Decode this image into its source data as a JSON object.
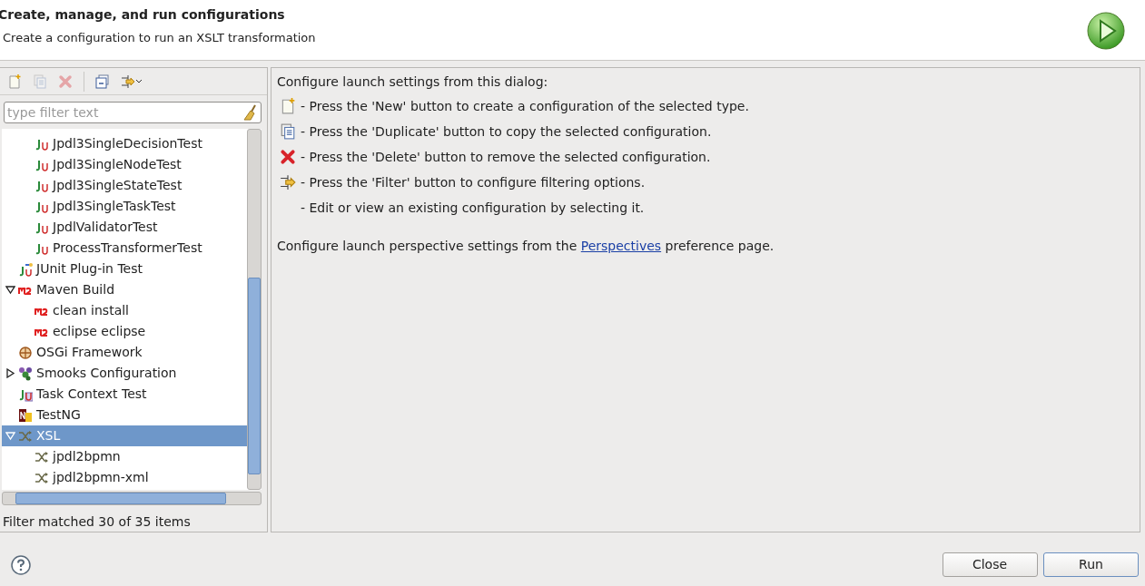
{
  "header": {
    "title": "Create, manage, and run configurations",
    "subtitle": "Create a configuration to run an XSLT transformation"
  },
  "toolbar": [
    {
      "kind": "new",
      "disabled": false
    },
    {
      "kind": "duplicate",
      "disabled": true
    },
    {
      "kind": "delete",
      "disabled": true
    },
    {
      "kind": "collapse",
      "disabled": false
    },
    {
      "kind": "filter",
      "disabled": false
    }
  ],
  "filter": {
    "placeholder": "type filter text"
  },
  "tree": {
    "scrolled_children": [
      {
        "label": "Jpdl3SingleDecisionTest",
        "kind": "junit",
        "selected": false
      },
      {
        "label": "Jpdl3SingleNodeTest",
        "kind": "junit",
        "selected": false
      },
      {
        "label": "Jpdl3SingleStateTest",
        "kind": "junit",
        "selected": false
      },
      {
        "label": "Jpdl3SingleTaskTest",
        "kind": "junit",
        "selected": false
      },
      {
        "label": "JpdlValidatorTest",
        "kind": "junit",
        "selected": false
      },
      {
        "label": "ProcessTransformerTest",
        "kind": "junit",
        "selected": false
      }
    ],
    "items": [
      {
        "label": "JUnit Plug-in Test",
        "kind": "junitplugin",
        "selected": false
      },
      {
        "label": "Maven Build",
        "kind": "m2",
        "selected": false,
        "expanded": true,
        "children": [
          {
            "label": "clean install",
            "kind": "m2",
            "selected": false
          },
          {
            "label": "eclipse eclipse",
            "kind": "m2",
            "selected": false
          }
        ]
      },
      {
        "label": "OSGi Framework",
        "kind": "osgi",
        "selected": false
      },
      {
        "label": "Smooks Configuration",
        "kind": "smooks",
        "selected": false,
        "expanded": false
      },
      {
        "label": "Task Context Test",
        "kind": "tasktest",
        "selected": false
      },
      {
        "label": "TestNG",
        "kind": "testng",
        "selected": false
      },
      {
        "label": "XSL",
        "kind": "xsl",
        "selected": true,
        "expanded": true,
        "children": [
          {
            "label": "jpdl2bpmn",
            "kind": "xsl",
            "selected": false
          },
          {
            "label": "jpdl2bpmn-xml",
            "kind": "xsl",
            "selected": false
          }
        ]
      }
    ]
  },
  "status": "Filter matched 30 of 35 items",
  "info": {
    "heading": "Configure launch settings from this dialog:",
    "lines": [
      {
        "kind": "new",
        "text": "- Press the 'New' button to create a configuration of the selected type."
      },
      {
        "kind": "duplicate",
        "text": "- Press the 'Duplicate' button to copy the selected configuration."
      },
      {
        "kind": "delete",
        "text": "- Press the 'Delete' button to remove the selected configuration."
      },
      {
        "kind": "filter",
        "text": "- Press the 'Filter' button to configure filtering options."
      },
      {
        "kind": "none",
        "text": "- Edit or view an existing configuration by selecting it."
      }
    ],
    "footer_before": "Configure launch perspective settings from the",
    "footer_link": "Perspectives",
    "footer_after": "preference page."
  },
  "buttons": [
    "Close",
    "Run"
  ]
}
